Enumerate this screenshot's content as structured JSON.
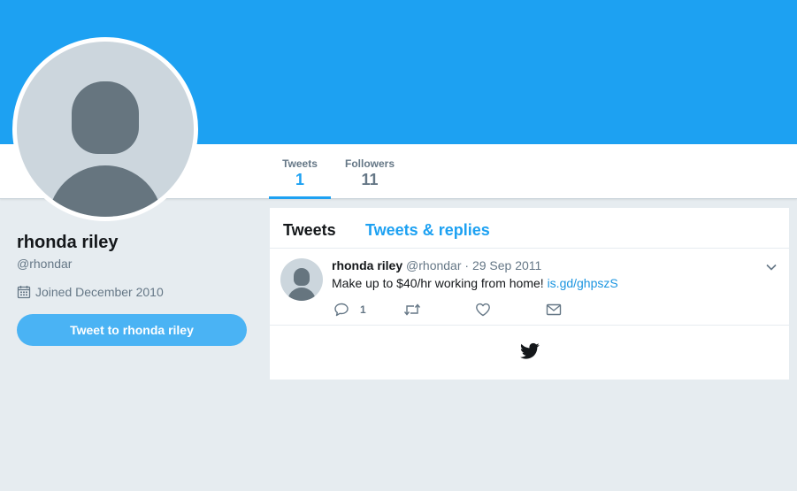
{
  "profile": {
    "name": "rhonda riley",
    "handle": "@rhondar",
    "joined": "Joined December 2010",
    "tweet_to_label": "Tweet to rhonda riley"
  },
  "nav": {
    "items": [
      {
        "label": "Tweets",
        "value": "1",
        "active": true
      },
      {
        "label": "Followers",
        "value": "11",
        "active": false
      }
    ]
  },
  "timeline": {
    "tabs": [
      {
        "label": "Tweets",
        "active": true
      },
      {
        "label": "Tweets & replies",
        "active": false
      }
    ],
    "tweets": [
      {
        "fullname": "rhonda riley",
        "meta": "@rhondar · 29 Sep 2011",
        "text": "Make up to $40/hr working from home! ",
        "link": "is.gd/ghpszS",
        "reply_count": "1"
      }
    ]
  },
  "icons": {
    "calendar": "calendar-icon",
    "reply": "reply-icon",
    "retweet": "retweet-icon",
    "like": "heart-icon",
    "dm": "envelope-icon",
    "caret": "chevron-down-icon",
    "footer": "twitter-bird-icon"
  },
  "colors": {
    "brand": "#1da1f2",
    "background": "#e6ecf0",
    "button": "#4ab3f4",
    "muted": "#657786",
    "link": "#1b95e0"
  }
}
